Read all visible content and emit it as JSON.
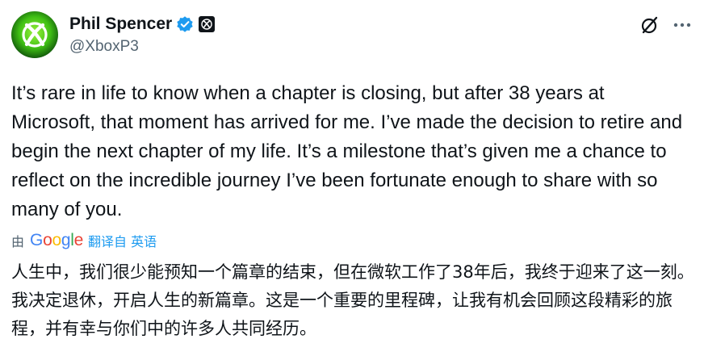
{
  "author": {
    "name": "Phil Spencer",
    "handle": "@XboxP3",
    "avatar_icon": "xbox-logo-icon",
    "verified_icon": "verified-badge-icon",
    "affiliation_icon": "xbox-affiliation-badge-icon",
    "verified_color": "#1d9bf0"
  },
  "actions": {
    "grok_icon": "grok-icon",
    "more_icon": "more-icon"
  },
  "post": {
    "text": "It’s rare in life to know when a chapter is closing, but after 38 years at Microsoft, that moment has arrived for me. I’ve made the decision to retire and begin the next chapter of my life. It’s a milestone that’s given me a chance to reflect on the incredible journey I’ve been fortunate enough to share with so many of you."
  },
  "translation": {
    "by_label": "由",
    "provider": "Google",
    "link_label": "翻译自 英语",
    "text": "人生中，我们很少能预知一个篇章的结束，但在微软工作了38年后，我终于迎来了这一刻。我决定退休，开启人生的新篇章。这是一个重要的里程碑，让我有机会回顾这段精彩的旅程，并有幸与你们中的许多人共同经历。"
  },
  "colors": {
    "text": "#0f1419",
    "secondary": "#536471",
    "link": "#1d9bf0"
  }
}
